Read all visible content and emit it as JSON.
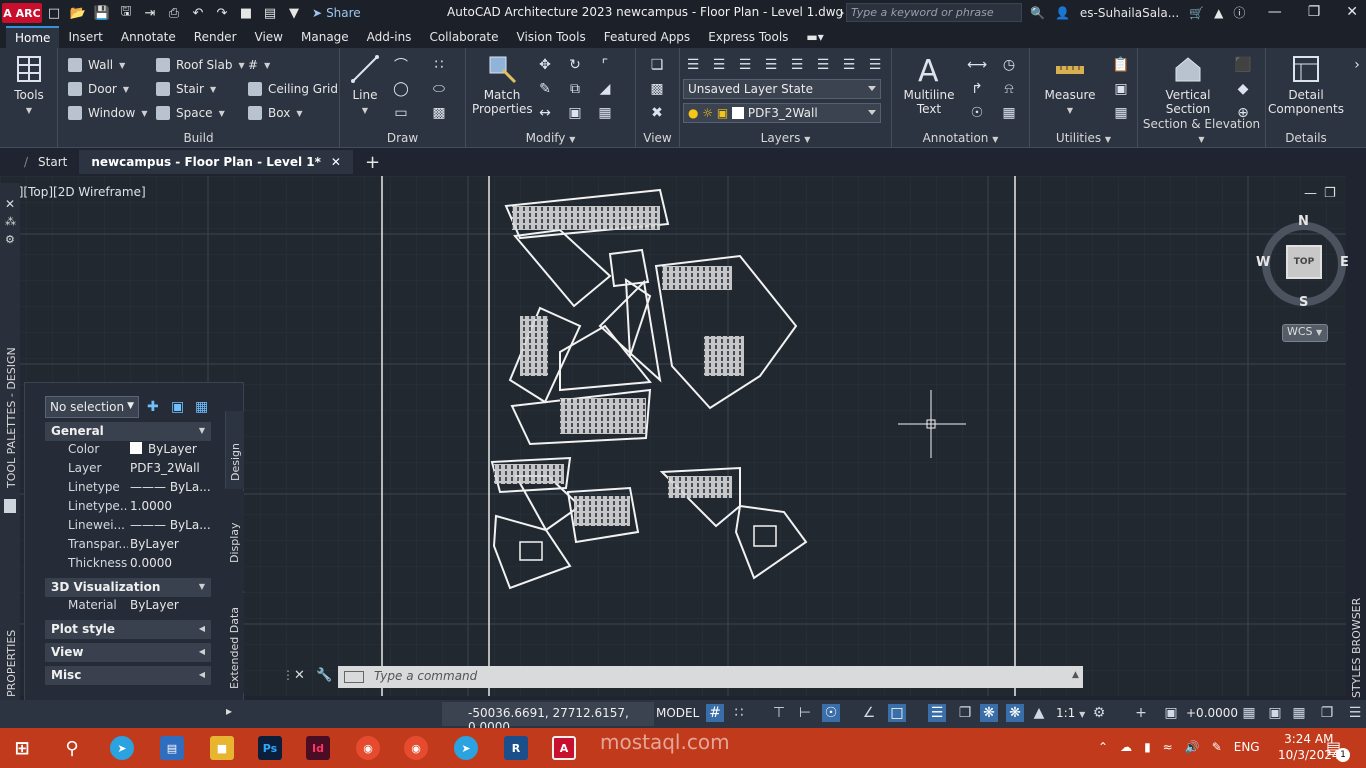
{
  "titlebar": {
    "app_badge": "A ARC",
    "share_label": "Share",
    "title": "AutoCAD Architecture 2023    newcampus - Floor Plan - Level 1.dwg",
    "search_placeholder": "Type a keyword or phrase",
    "user": "es-SuhailaSala..."
  },
  "menu": {
    "tabs": [
      "Home",
      "Insert",
      "Annotate",
      "Render",
      "View",
      "Manage",
      "Add-ins",
      "Collaborate",
      "Vision Tools",
      "Featured Apps",
      "Express Tools"
    ]
  },
  "ribbon": {
    "tools": "Tools",
    "build": {
      "label": "Build",
      "wall": "Wall",
      "door": "Door",
      "window": "Window",
      "roof_slab": "Roof Slab",
      "stair": "Stair",
      "space": "Space",
      "ceiling_grid": "Ceiling Grid",
      "box": "Box"
    },
    "draw": {
      "label": "Draw",
      "line": "Line"
    },
    "modify": {
      "label": "Modify",
      "match_properties_1": "Match",
      "match_properties_2": "Properties"
    },
    "view": {
      "label": "View"
    },
    "layers": {
      "label": "Layers",
      "layer_state": "Unsaved Layer State",
      "current_layer": "PDF3_2Wall"
    },
    "annotation": {
      "label": "Annotation",
      "multiline_1": "Multiline",
      "multiline_2": "Text"
    },
    "utilities": {
      "label": "Utilities",
      "measure": "Measure"
    },
    "section": {
      "label": "Section & Elevation",
      "vertical_1": "Vertical",
      "vertical_2": "Section"
    },
    "details": {
      "label": "Details",
      "detail_1": "Detail",
      "detail_2": "Components"
    }
  },
  "doctabs": {
    "start": "Start",
    "active": "newcampus - Floor Plan - Level 1*"
  },
  "viewport": {
    "label": "[−][Top][2D Wireframe]",
    "viewcube_top": "TOP",
    "compass_n": "N",
    "compass_s": "S",
    "compass_e": "E",
    "compass_w": "W",
    "wcs": "WCS"
  },
  "left_palette": {
    "tool_palettes": "TOOL PALETTES - DESIGN",
    "properties": "PROPERTIES"
  },
  "properties": {
    "selection": "No selection",
    "general": "General",
    "rows": [
      {
        "k": "Color",
        "v": "ByLayer"
      },
      {
        "k": "Layer",
        "v": "PDF3_2Wall"
      },
      {
        "k": "Linetype",
        "v": "——— ByLa..."
      },
      {
        "k": "Linetype...",
        "v": "1.0000"
      },
      {
        "k": "Linewei...",
        "v": "——— ByLa..."
      },
      {
        "k": "Transpar...",
        "v": "ByLayer"
      },
      {
        "k": "Thickness",
        "v": "0.0000"
      }
    ],
    "viz": "3D Visualization",
    "material_k": "Material",
    "material_v": "ByLayer",
    "plot_style": "Plot style",
    "view": "View",
    "misc": "Misc",
    "tab_design": "Design",
    "tab_display": "Display",
    "tab_extended": "Extended Data"
  },
  "styles_browser": "STYLES BROWSER",
  "command": {
    "placeholder": "Type a command"
  },
  "status": {
    "coords": "-50036.6691, 27712.6157, 0.0000",
    "model": "MODEL",
    "scale": "1:1",
    "elevation": "+0.0000"
  },
  "taskbar": {
    "lang": "ENG",
    "time": "3:24 AM",
    "date": "10/3/2024",
    "notify_count": "1"
  },
  "watermark": "mostaql.com",
  "colors": {
    "accent": "#3a8fd8",
    "taskbar": "#c13a1b",
    "viewport": "#212830"
  }
}
